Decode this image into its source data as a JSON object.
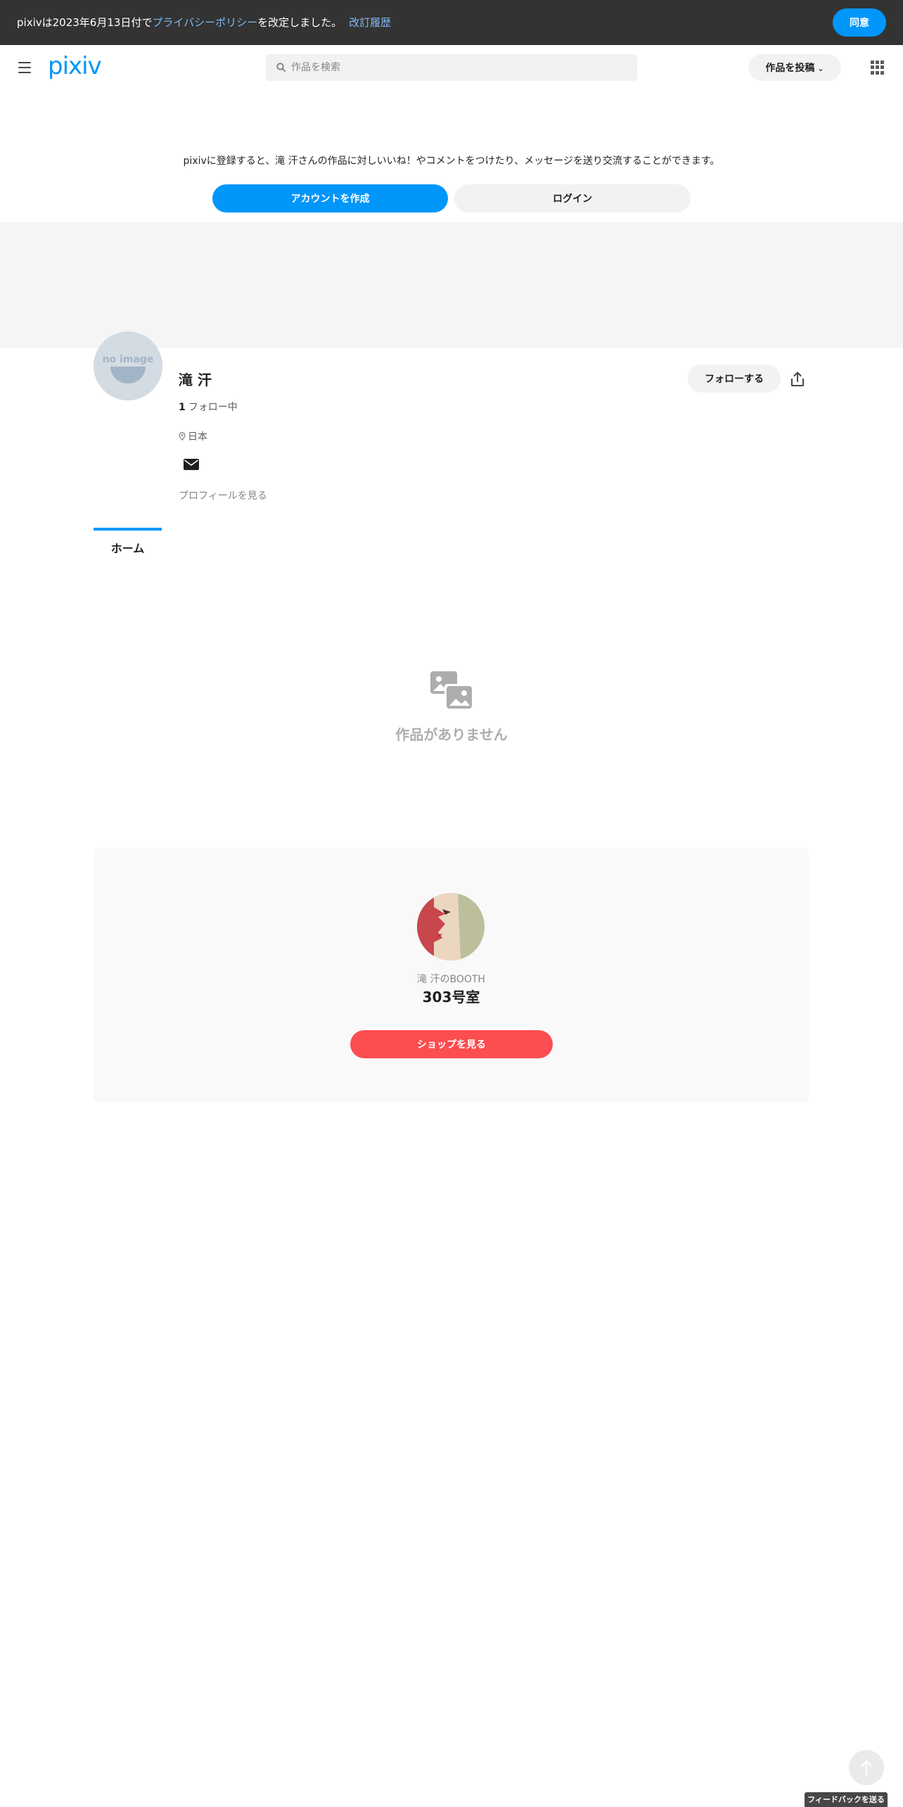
{
  "banner": {
    "text_before": "pixivは2023年6月13日付で",
    "policy_link": "プライバシーポリシー",
    "text_after": "を改定しました。",
    "history_link": "改訂履歴",
    "agree_label": "同意"
  },
  "header": {
    "logo": "pixiv",
    "search_placeholder": "作品を検索",
    "post_label": "作品を投稿",
    "icons": [
      "menu-icon",
      "search-icon",
      "chevron-down-icon",
      "apps-grid-icon"
    ]
  },
  "register": {
    "message": "pixivに登録すると、滝 汗さんの作品に対しいいね！やコメントをつけたり、メッセージを送り交流することができます。",
    "create_label": "アカウントを作成",
    "login_label": "ログイン"
  },
  "profile": {
    "avatar_text": "no image",
    "name": "滝 汗",
    "following_count": "1",
    "following_label": "フォロー中",
    "location": "日本",
    "profile_link": "プロフィールを見る",
    "follow_label": "フォローする",
    "icons": [
      "pin-icon",
      "mail-icon",
      "share-icon"
    ]
  },
  "tabs": [
    {
      "label": "ホーム",
      "active": true
    }
  ],
  "empty": {
    "message": "作品がありません",
    "icon": "images-icon"
  },
  "booth": {
    "label": "滝 汗のBOOTH",
    "name": "303号室",
    "shop_label": "ショップを見る"
  },
  "footer": {
    "feedback_label": "フィードバックを送る",
    "scroll_top_icon": "arrow-up-icon"
  },
  "colors": {
    "accent": "#0096fa",
    "booth_red": "#fc4d50",
    "banner_bg": "#333333"
  }
}
